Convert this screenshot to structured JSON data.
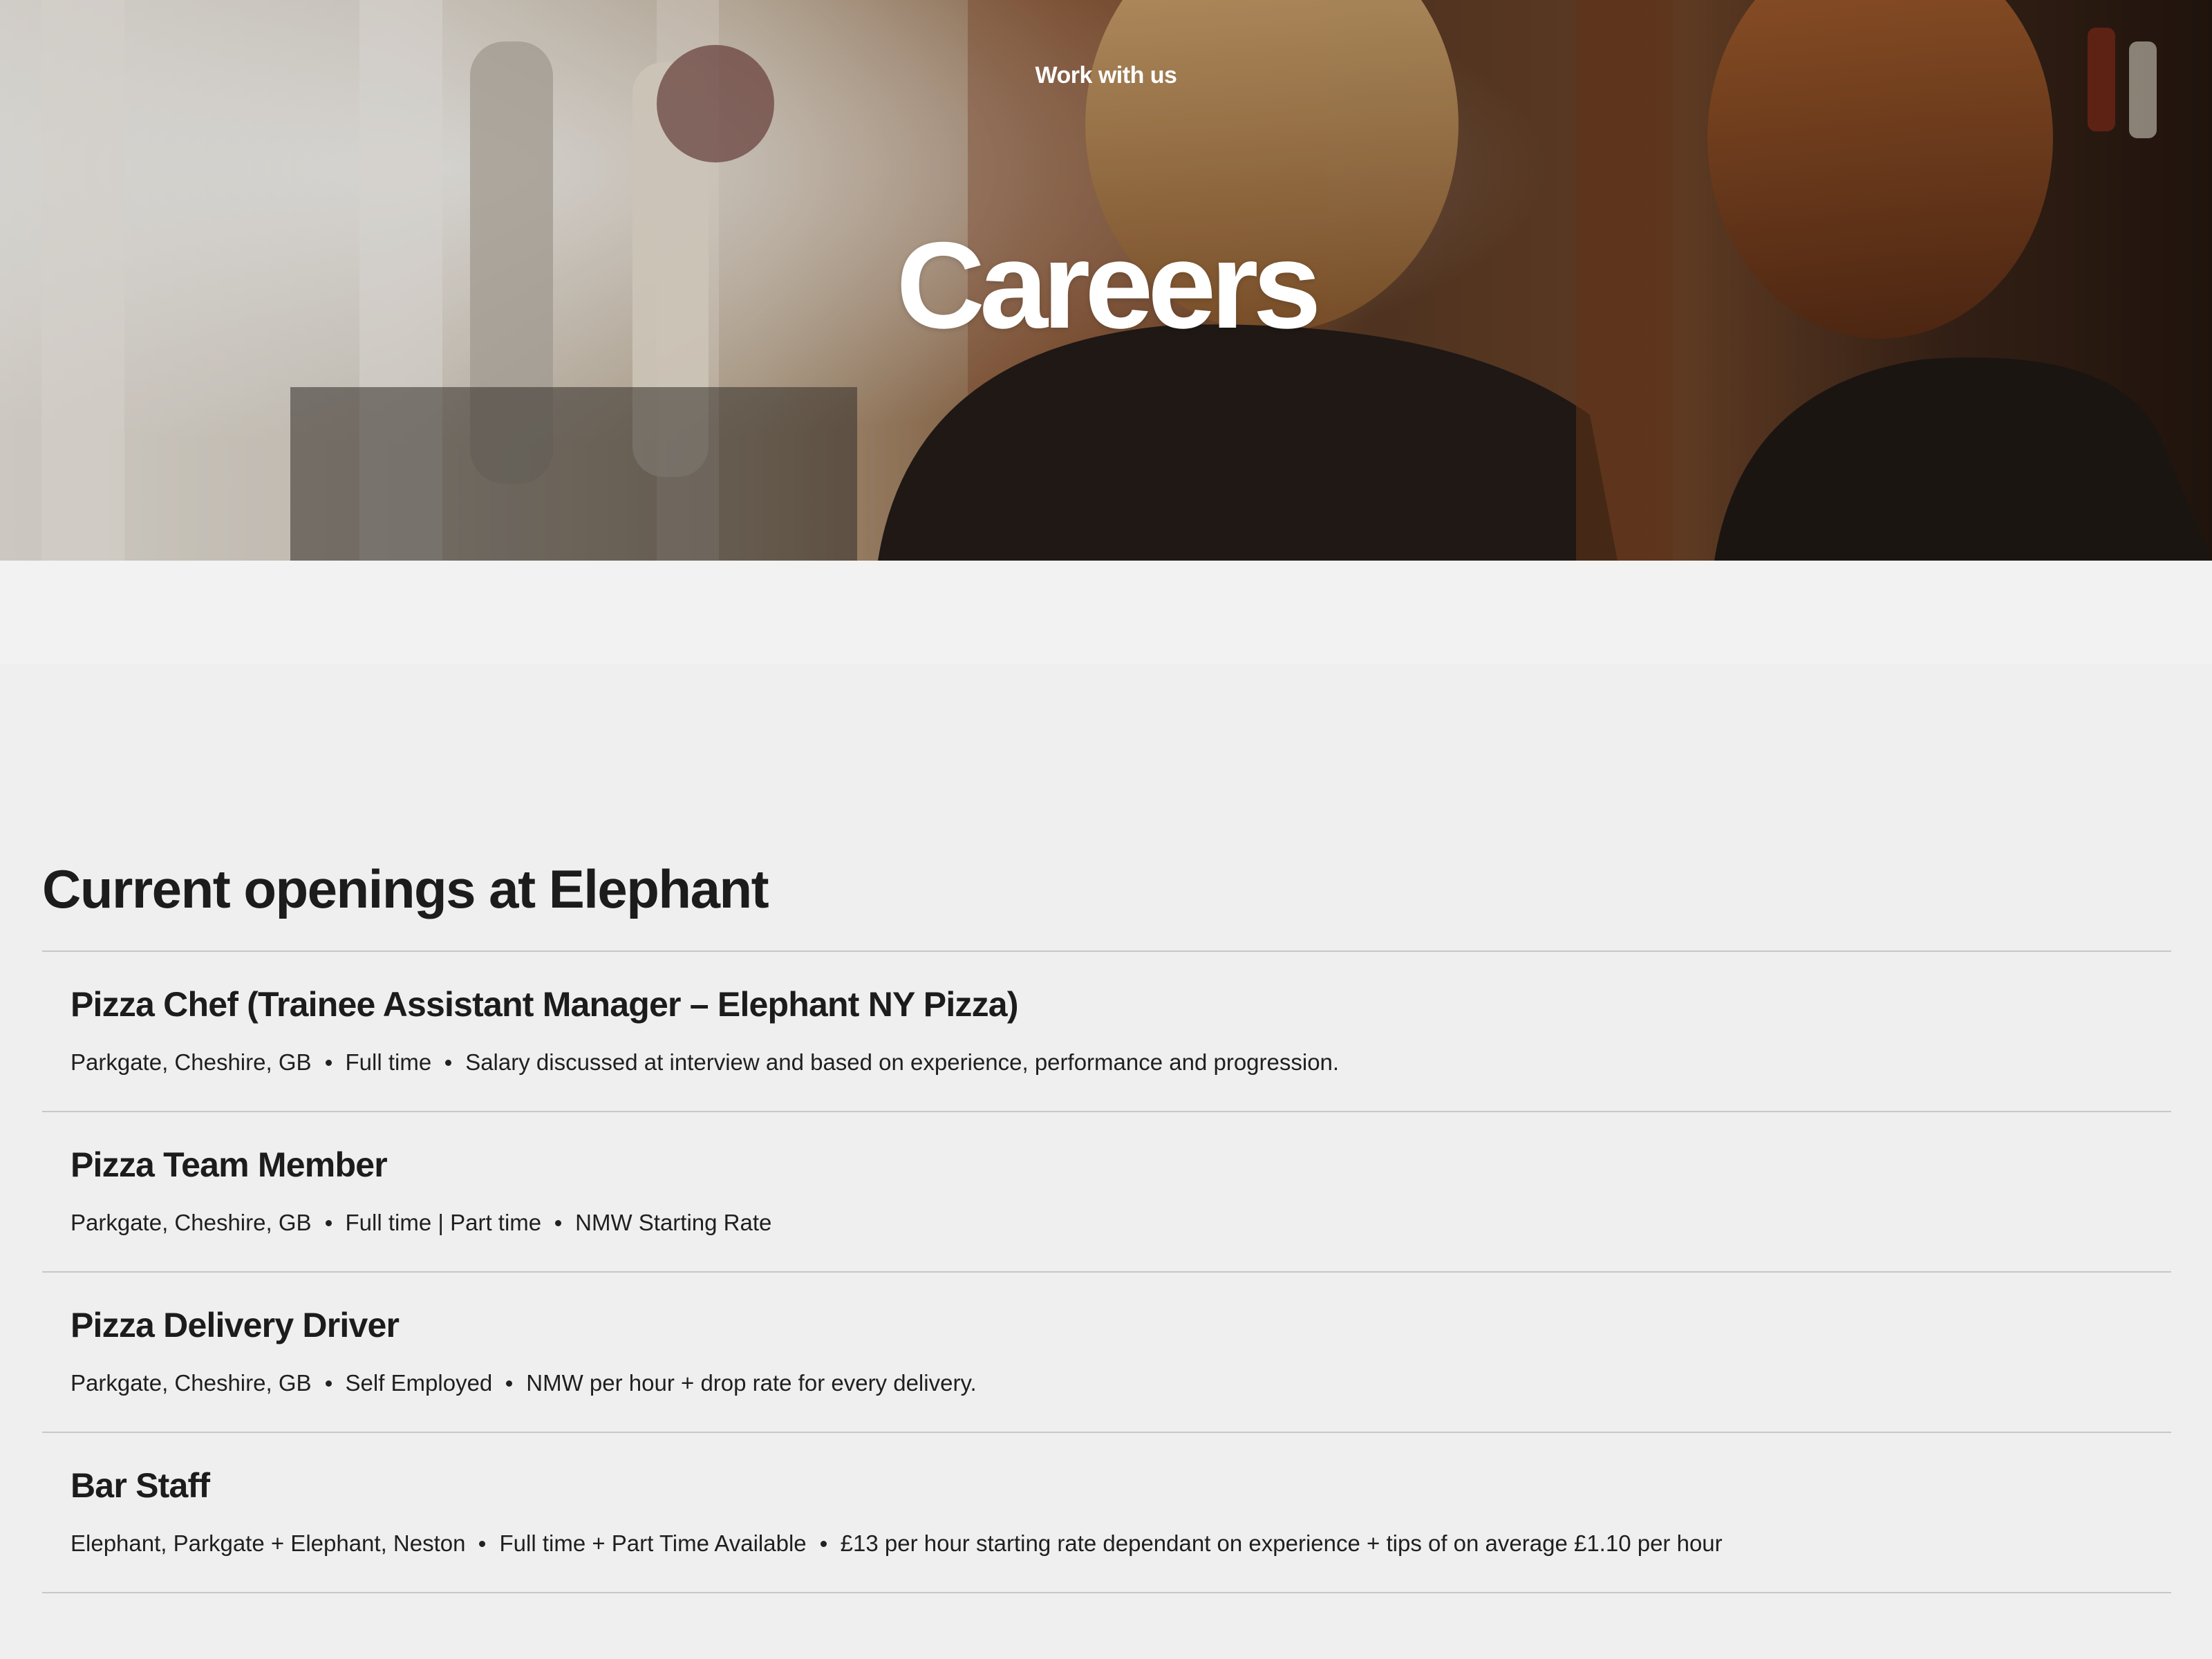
{
  "hero": {
    "eyebrow": "Work with us",
    "title": "Careers"
  },
  "openings": {
    "title": "Current openings at Elephant",
    "jobs": [
      {
        "title": "Pizza Chef (Trainee Assistant Manager – Elephant NY Pizza)",
        "location": "Parkgate, Cheshire, GB",
        "type": "Full time",
        "pay": "Salary discussed at interview and based on experience, performance and progression."
      },
      {
        "title": "Pizza Team Member",
        "location": "Parkgate, Cheshire, GB",
        "type": "Full time | Part time",
        "pay": "NMW Starting Rate"
      },
      {
        "title": "Pizza Delivery Driver",
        "location": "Parkgate, Cheshire, GB",
        "type": "Self Employed",
        "pay": "NMW per hour + drop rate for every delivery."
      },
      {
        "title": "Bar Staff",
        "location": "Elephant, Parkgate + Elephant, Neston",
        "type": "Full time + Part Time Available",
        "pay": "£13 per hour starting rate dependant on experience + tips of on average £1.10 per hour"
      }
    ]
  },
  "colors": {
    "page_bg": "#efefef",
    "text": "#1c1c1c",
    "divider": "#c7c7c7"
  }
}
